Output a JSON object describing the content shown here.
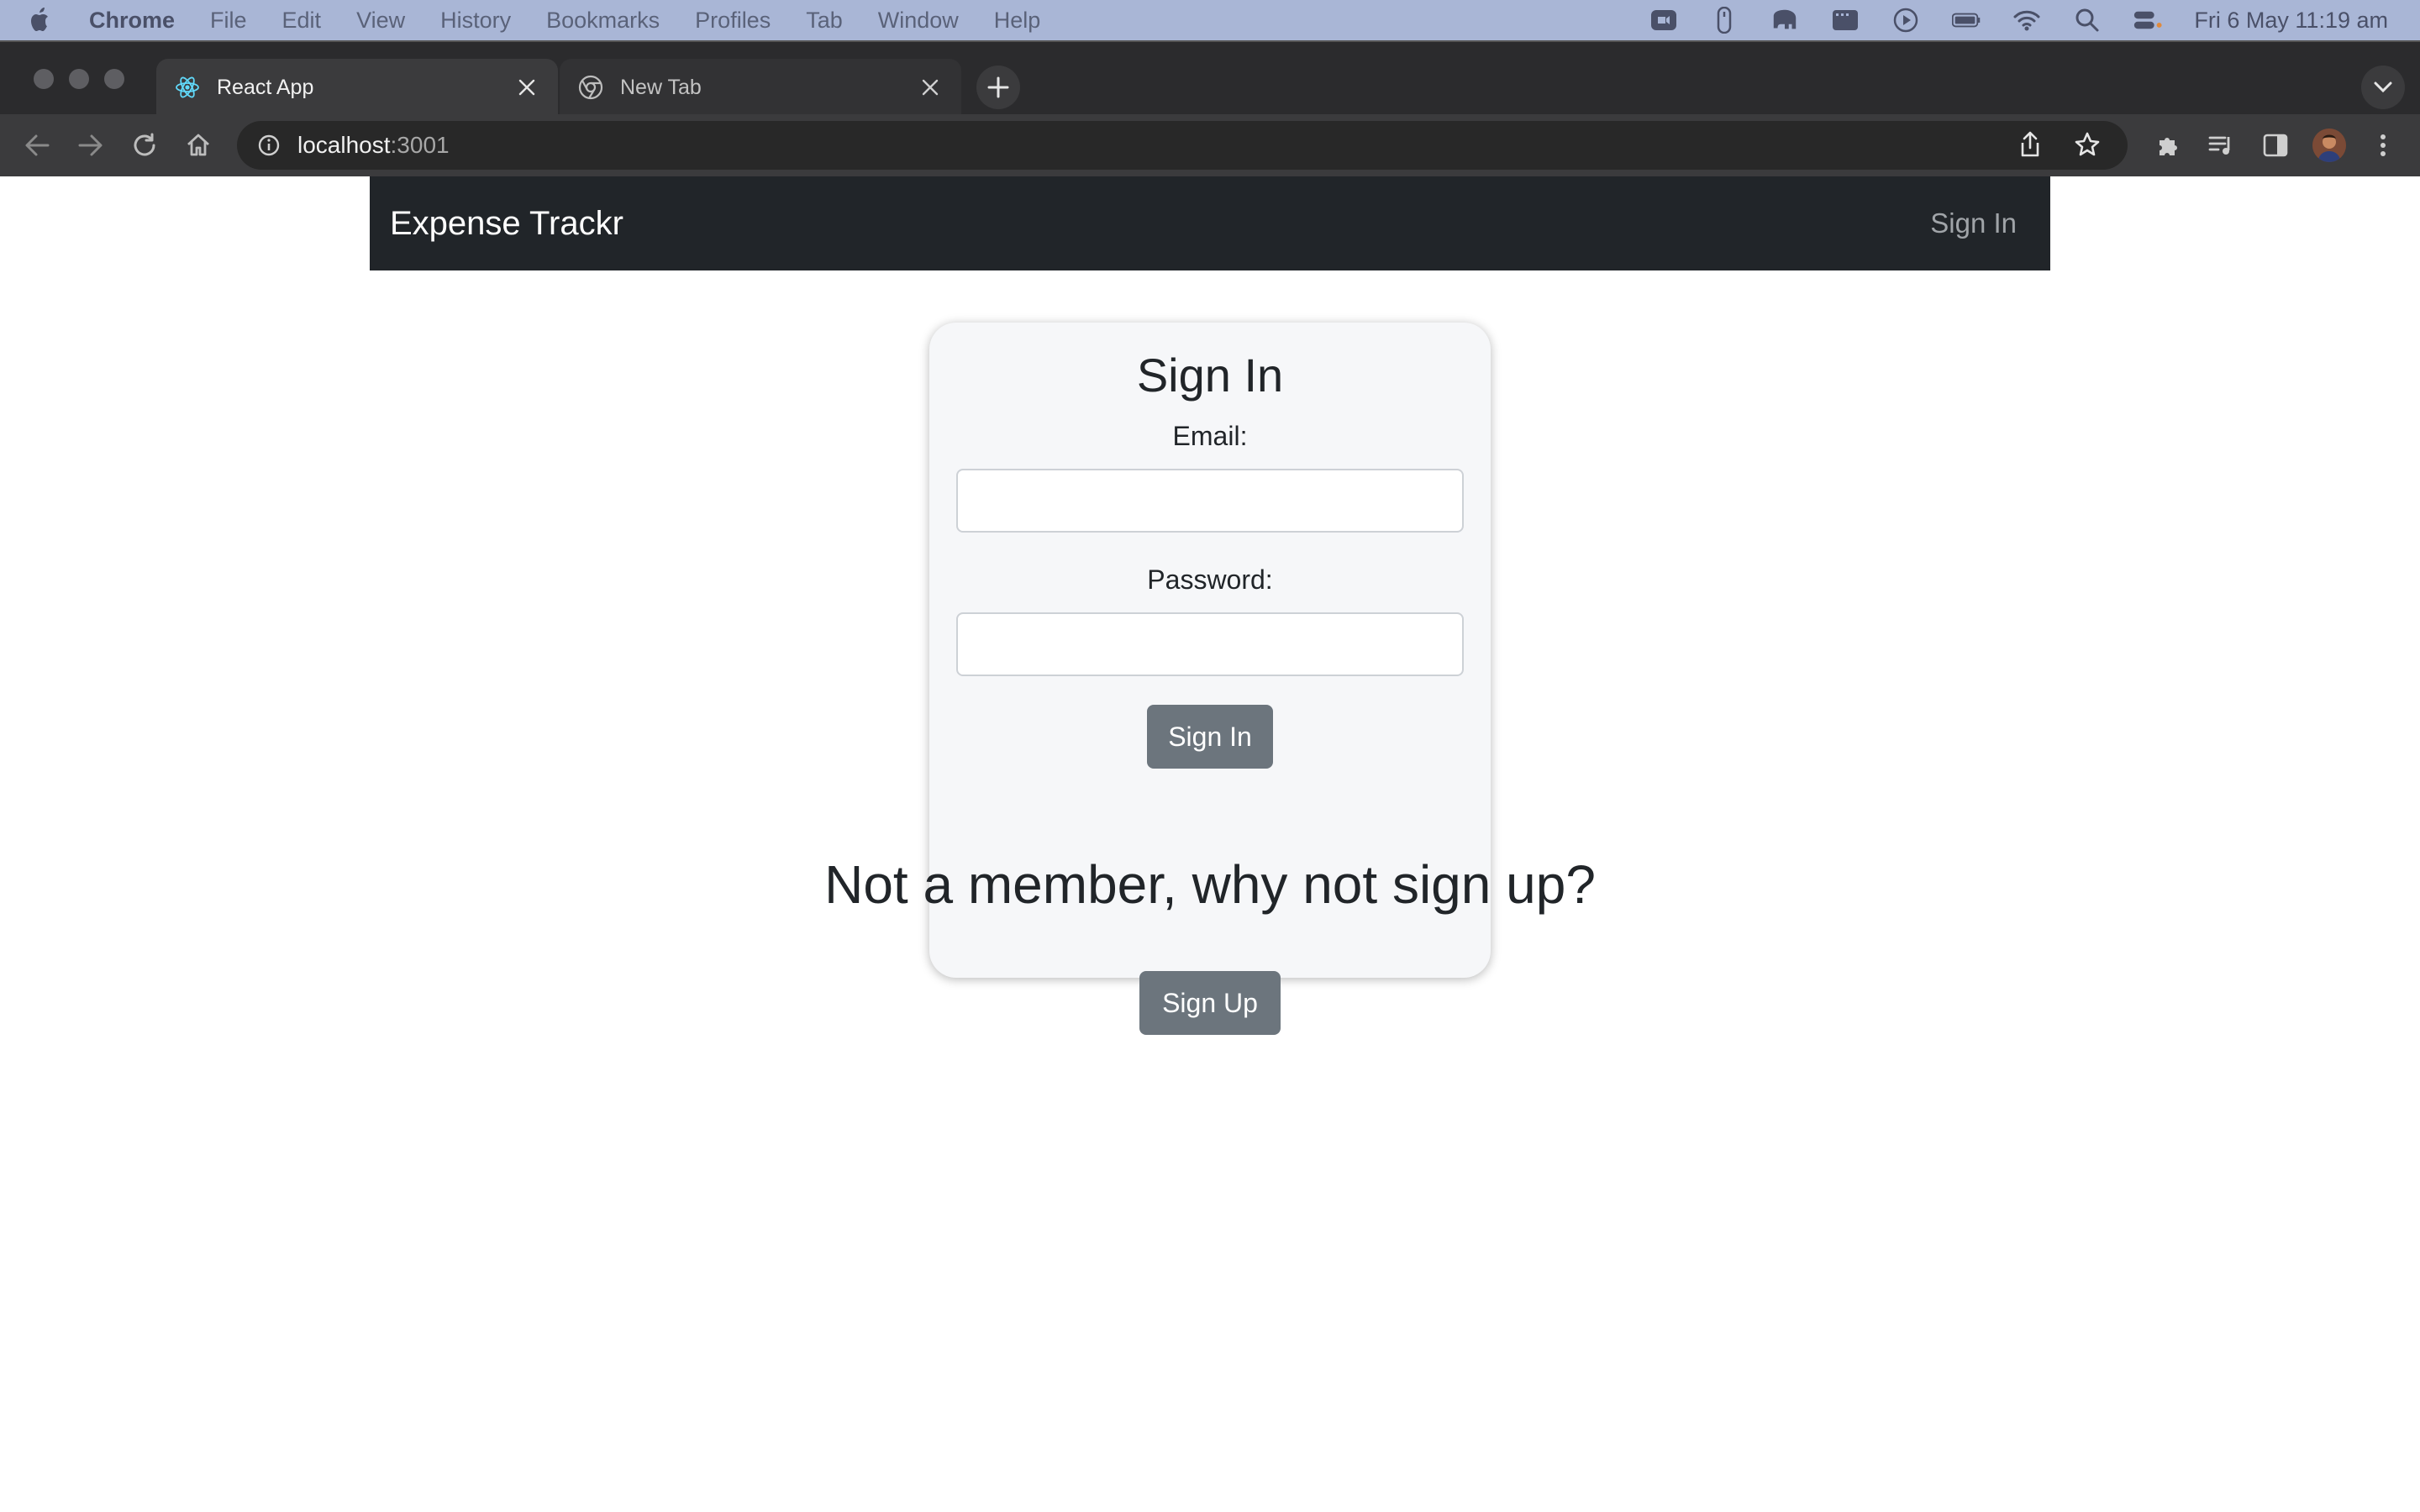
{
  "menubar": {
    "app_name": "Chrome",
    "items": [
      "File",
      "Edit",
      "View",
      "History",
      "Bookmarks",
      "Profiles",
      "Tab",
      "Window",
      "Help"
    ],
    "clock": "Fri 6 May  11:19 am"
  },
  "tabs": [
    {
      "title": "React App",
      "favicon": "react-icon",
      "active": true
    },
    {
      "title": "New Tab",
      "favicon": "chrome-icon",
      "active": false
    }
  ],
  "address_bar": {
    "host": "localhost",
    "port": ":3001"
  },
  "app": {
    "brand": "Expense Trackr",
    "nav_signin": "Sign In"
  },
  "signin_card": {
    "title": "Sign In",
    "email_label": "Email:",
    "email_value": "",
    "password_label": "Password:",
    "password_value": "",
    "submit_label": "Sign In"
  },
  "signup": {
    "prompt": "Not a member, why not sign up?",
    "button_label": "Sign Up"
  },
  "colors": {
    "navbar_bg": "#212529",
    "button_bg": "#6c757d",
    "card_bg": "#f6f7f9"
  }
}
